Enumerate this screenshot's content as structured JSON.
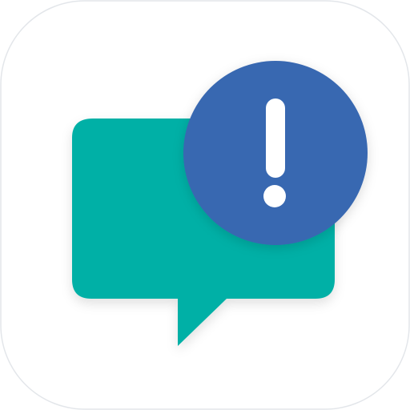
{
  "icon": {
    "name": "chat-alert-app-icon",
    "background_color": "#ffffff",
    "border_color": "#e3e6ea",
    "speech_bubble": {
      "icon": "speech-bubble-icon",
      "color": "#00b0a6"
    },
    "alert_badge": {
      "icon": "exclamation-icon",
      "circle_color": "#3867b1",
      "glyph_color": "#ffffff"
    }
  }
}
